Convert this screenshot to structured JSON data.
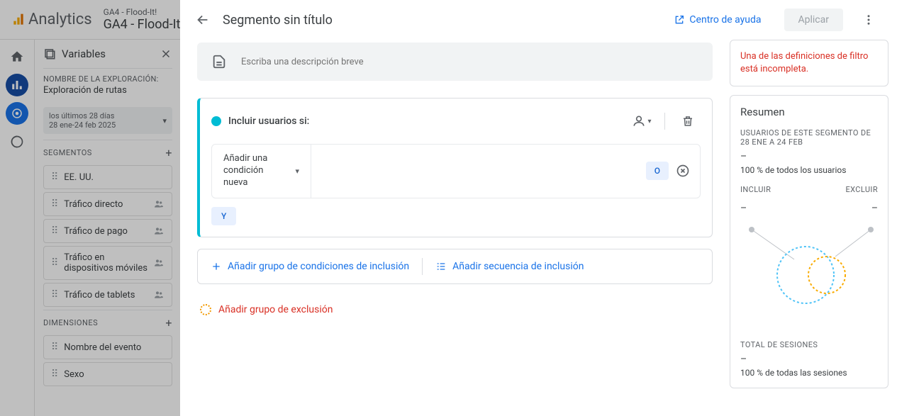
{
  "bg": {
    "logoText": "Analytics",
    "crumb1": "GA4 - Flood-It!",
    "crumb2": "GA4 - Flood-It!",
    "panelTitle": "Variables",
    "expLabel": "NOMBRE DE LA EXPLORACIÓN:",
    "expName": "Exploración de rutas",
    "dateLine1": "los últimos 28 días",
    "dateLine2": "28 ene-24 feb 2025",
    "segLabel": "SEGMENTOS",
    "segs": [
      "EE. UU.",
      "Tráfico directo",
      "Tráfico de pago",
      "Tráfico en dispositivos móviles",
      "Tráfico de tablets"
    ],
    "dimLabel": "DIMENSIONES",
    "dims": [
      "Nombre del evento",
      "Sexo"
    ]
  },
  "modal": {
    "title": "Segmento sin título",
    "helpText": "Centro de ayuda",
    "applyText": "Aplicar",
    "descPlaceholder": "Escriba una descripción breve",
    "includeTitle": "Incluir usuarios si:",
    "condText": "Añadir una condición nueva",
    "orText": "O",
    "andText": "Y",
    "addGroup": "Añadir grupo de condiciones de inclusión",
    "addSeq": "Añadir secuencia de inclusión",
    "addExcl": "Añadir grupo de exclusión"
  },
  "summary": {
    "warn": "Una de las definiciones de filtro está incompleta.",
    "title": "Resumen",
    "usersLabel": "USUARIOS DE ESTE SEGMENTO DE 28 ENE A 24 FEB",
    "dash": "–",
    "usersPct": "100 % de todos los usuarios",
    "incl": "INCLUIR",
    "excl": "EXCLUIR",
    "sessLabel": "TOTAL DE SESIONES",
    "sessPct": "100 % de todas las sesiones"
  }
}
